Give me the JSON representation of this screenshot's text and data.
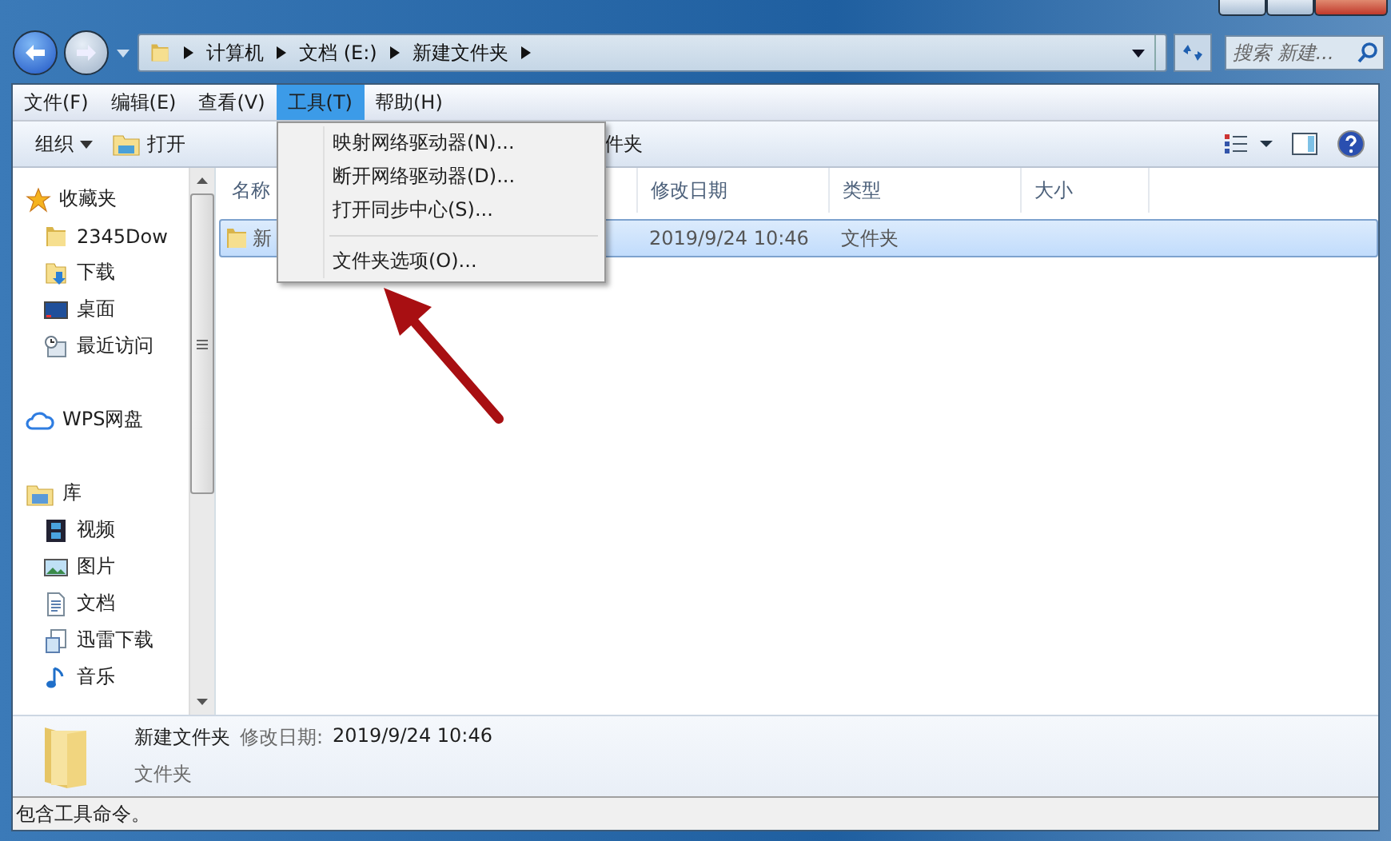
{
  "address_bar": {
    "segments": [
      "计算机",
      "文档 (E:)",
      "新建文件夹"
    ]
  },
  "search": {
    "placeholder": "搜索 新建..."
  },
  "menu_bar": [
    {
      "label": "文件(F)",
      "selected": false
    },
    {
      "label": "编辑(E)",
      "selected": false
    },
    {
      "label": "查看(V)",
      "selected": false
    },
    {
      "label": "工具(T)",
      "selected": true
    },
    {
      "label": "帮助(H)",
      "selected": false
    }
  ],
  "open_menu": {
    "items": [
      {
        "kind": "item",
        "label": "映射网络驱动器(N)..."
      },
      {
        "kind": "item",
        "label": "断开网络驱动器(D)..."
      },
      {
        "kind": "item",
        "label": "打开同步中心(S)..."
      },
      {
        "kind": "separator"
      },
      {
        "kind": "item",
        "label": "文件夹选项(O)..."
      }
    ]
  },
  "toolbar": {
    "buttons": [
      {
        "kind": "dropdown",
        "label": "组织"
      },
      {
        "kind": "open",
        "label": "打开"
      },
      {
        "kind": "plain",
        "label": "件夹"
      }
    ]
  },
  "navigation": {
    "groups": [
      {
        "kind": "star",
        "label": "收藏夹",
        "children": [
          {
            "kind": "folder",
            "label": "2345Dow"
          },
          {
            "kind": "download",
            "label": "下载"
          },
          {
            "kind": "desktop",
            "label": "桌面"
          },
          {
            "kind": "recent",
            "label": "最近访问"
          }
        ]
      },
      {
        "kind": "cloud",
        "label": "WPS网盘"
      },
      {
        "kind": "library",
        "label": "库",
        "children": [
          {
            "kind": "video",
            "label": "视频"
          },
          {
            "kind": "picture",
            "label": "图片"
          },
          {
            "kind": "document",
            "label": "文档"
          },
          {
            "kind": "xunlei",
            "label": "迅雷下载"
          },
          {
            "kind": "music",
            "label": "音乐"
          }
        ]
      }
    ]
  },
  "columns": [
    "名称",
    "修改日期",
    "类型",
    "大小"
  ],
  "rows": [
    {
      "name": "新",
      "modified": "2019/9/24 10:46",
      "type": "文件夹",
      "selected": true
    }
  ],
  "details": {
    "name": "新建文件夹",
    "label": "修改日期:",
    "value": "2019/9/24 10:46",
    "type": "文件夹"
  },
  "status_bar": "包含工具命令。"
}
